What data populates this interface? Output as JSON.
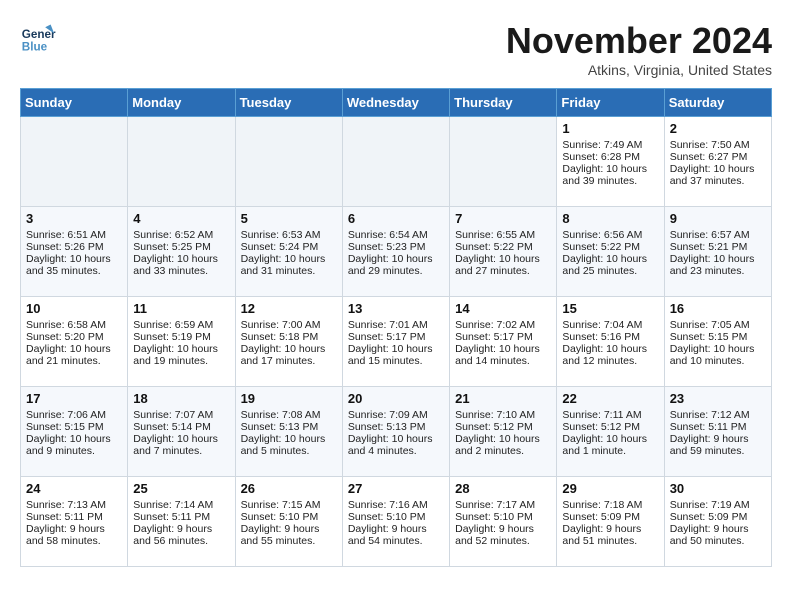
{
  "header": {
    "logo": {
      "line1": "General",
      "line2": "Blue"
    },
    "title": "November 2024",
    "location": "Atkins, Virginia, United States"
  },
  "days_of_week": [
    "Sunday",
    "Monday",
    "Tuesday",
    "Wednesday",
    "Thursday",
    "Friday",
    "Saturday"
  ],
  "weeks": [
    [
      {
        "day": "",
        "empty": true
      },
      {
        "day": "",
        "empty": true
      },
      {
        "day": "",
        "empty": true
      },
      {
        "day": "",
        "empty": true
      },
      {
        "day": "",
        "empty": true
      },
      {
        "day": "1",
        "sunrise": "Sunrise: 7:49 AM",
        "sunset": "Sunset: 6:28 PM",
        "daylight": "Daylight: 10 hours and 39 minutes."
      },
      {
        "day": "2",
        "sunrise": "Sunrise: 7:50 AM",
        "sunset": "Sunset: 6:27 PM",
        "daylight": "Daylight: 10 hours and 37 minutes."
      }
    ],
    [
      {
        "day": "3",
        "sunrise": "Sunrise: 6:51 AM",
        "sunset": "Sunset: 5:26 PM",
        "daylight": "Daylight: 10 hours and 35 minutes."
      },
      {
        "day": "4",
        "sunrise": "Sunrise: 6:52 AM",
        "sunset": "Sunset: 5:25 PM",
        "daylight": "Daylight: 10 hours and 33 minutes."
      },
      {
        "day": "5",
        "sunrise": "Sunrise: 6:53 AM",
        "sunset": "Sunset: 5:24 PM",
        "daylight": "Daylight: 10 hours and 31 minutes."
      },
      {
        "day": "6",
        "sunrise": "Sunrise: 6:54 AM",
        "sunset": "Sunset: 5:23 PM",
        "daylight": "Daylight: 10 hours and 29 minutes."
      },
      {
        "day": "7",
        "sunrise": "Sunrise: 6:55 AM",
        "sunset": "Sunset: 5:22 PM",
        "daylight": "Daylight: 10 hours and 27 minutes."
      },
      {
        "day": "8",
        "sunrise": "Sunrise: 6:56 AM",
        "sunset": "Sunset: 5:22 PM",
        "daylight": "Daylight: 10 hours and 25 minutes."
      },
      {
        "day": "9",
        "sunrise": "Sunrise: 6:57 AM",
        "sunset": "Sunset: 5:21 PM",
        "daylight": "Daylight: 10 hours and 23 minutes."
      }
    ],
    [
      {
        "day": "10",
        "sunrise": "Sunrise: 6:58 AM",
        "sunset": "Sunset: 5:20 PM",
        "daylight": "Daylight: 10 hours and 21 minutes."
      },
      {
        "day": "11",
        "sunrise": "Sunrise: 6:59 AM",
        "sunset": "Sunset: 5:19 PM",
        "daylight": "Daylight: 10 hours and 19 minutes."
      },
      {
        "day": "12",
        "sunrise": "Sunrise: 7:00 AM",
        "sunset": "Sunset: 5:18 PM",
        "daylight": "Daylight: 10 hours and 17 minutes."
      },
      {
        "day": "13",
        "sunrise": "Sunrise: 7:01 AM",
        "sunset": "Sunset: 5:17 PM",
        "daylight": "Daylight: 10 hours and 15 minutes."
      },
      {
        "day": "14",
        "sunrise": "Sunrise: 7:02 AM",
        "sunset": "Sunset: 5:17 PM",
        "daylight": "Daylight: 10 hours and 14 minutes."
      },
      {
        "day": "15",
        "sunrise": "Sunrise: 7:04 AM",
        "sunset": "Sunset: 5:16 PM",
        "daylight": "Daylight: 10 hours and 12 minutes."
      },
      {
        "day": "16",
        "sunrise": "Sunrise: 7:05 AM",
        "sunset": "Sunset: 5:15 PM",
        "daylight": "Daylight: 10 hours and 10 minutes."
      }
    ],
    [
      {
        "day": "17",
        "sunrise": "Sunrise: 7:06 AM",
        "sunset": "Sunset: 5:15 PM",
        "daylight": "Daylight: 10 hours and 9 minutes."
      },
      {
        "day": "18",
        "sunrise": "Sunrise: 7:07 AM",
        "sunset": "Sunset: 5:14 PM",
        "daylight": "Daylight: 10 hours and 7 minutes."
      },
      {
        "day": "19",
        "sunrise": "Sunrise: 7:08 AM",
        "sunset": "Sunset: 5:13 PM",
        "daylight": "Daylight: 10 hours and 5 minutes."
      },
      {
        "day": "20",
        "sunrise": "Sunrise: 7:09 AM",
        "sunset": "Sunset: 5:13 PM",
        "daylight": "Daylight: 10 hours and 4 minutes."
      },
      {
        "day": "21",
        "sunrise": "Sunrise: 7:10 AM",
        "sunset": "Sunset: 5:12 PM",
        "daylight": "Daylight: 10 hours and 2 minutes."
      },
      {
        "day": "22",
        "sunrise": "Sunrise: 7:11 AM",
        "sunset": "Sunset: 5:12 PM",
        "daylight": "Daylight: 10 hours and 1 minute."
      },
      {
        "day": "23",
        "sunrise": "Sunrise: 7:12 AM",
        "sunset": "Sunset: 5:11 PM",
        "daylight": "Daylight: 9 hours and 59 minutes."
      }
    ],
    [
      {
        "day": "24",
        "sunrise": "Sunrise: 7:13 AM",
        "sunset": "Sunset: 5:11 PM",
        "daylight": "Daylight: 9 hours and 58 minutes."
      },
      {
        "day": "25",
        "sunrise": "Sunrise: 7:14 AM",
        "sunset": "Sunset: 5:11 PM",
        "daylight": "Daylight: 9 hours and 56 minutes."
      },
      {
        "day": "26",
        "sunrise": "Sunrise: 7:15 AM",
        "sunset": "Sunset: 5:10 PM",
        "daylight": "Daylight: 9 hours and 55 minutes."
      },
      {
        "day": "27",
        "sunrise": "Sunrise: 7:16 AM",
        "sunset": "Sunset: 5:10 PM",
        "daylight": "Daylight: 9 hours and 54 minutes."
      },
      {
        "day": "28",
        "sunrise": "Sunrise: 7:17 AM",
        "sunset": "Sunset: 5:10 PM",
        "daylight": "Daylight: 9 hours and 52 minutes."
      },
      {
        "day": "29",
        "sunrise": "Sunrise: 7:18 AM",
        "sunset": "Sunset: 5:09 PM",
        "daylight": "Daylight: 9 hours and 51 minutes."
      },
      {
        "day": "30",
        "sunrise": "Sunrise: 7:19 AM",
        "sunset": "Sunset: 5:09 PM",
        "daylight": "Daylight: 9 hours and 50 minutes."
      }
    ]
  ]
}
